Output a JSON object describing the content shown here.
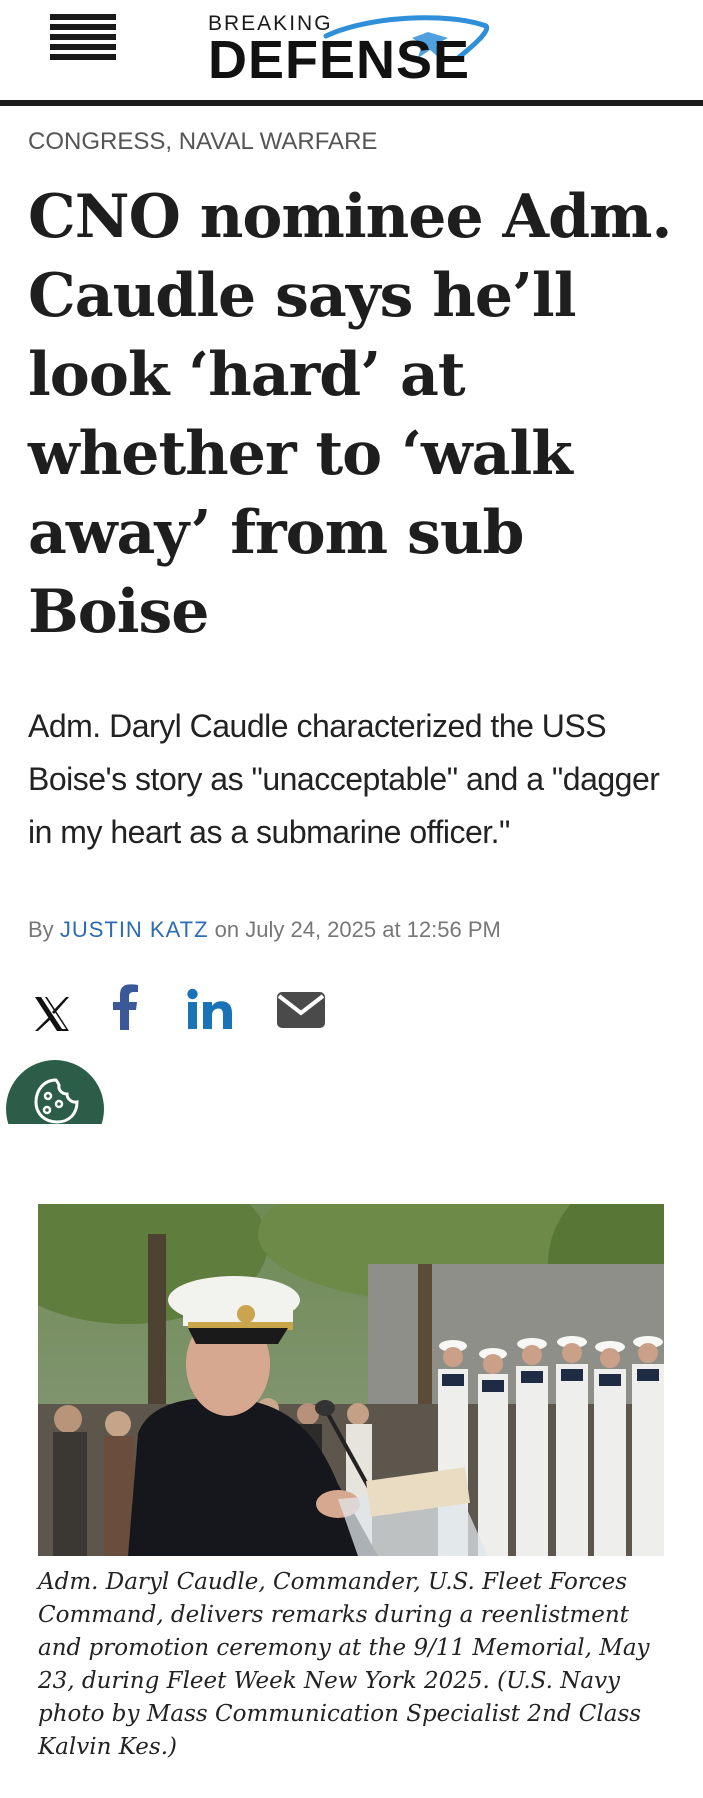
{
  "header": {
    "logo_top": "BREAKING",
    "logo_bottom": "DEFENSE",
    "menu_icon": "hamburger-menu-icon"
  },
  "article": {
    "categories": [
      "CONGRESS",
      "NAVAL WARFARE"
    ],
    "category_separator": ",",
    "headline": "CNO nominee Adm. Caudle says he’ll look ‘hard’ at whether to ‘walk away’ from sub Boise",
    "dek": "Adm. Daryl Caudle characterized the USS Boise's story as \"unacceptable\" and a \"dagger in my heart as a submarine officer.\"",
    "byline": {
      "prefix": "By",
      "author": "JUSTIN KATZ",
      "date_text": "on July 24, 2025 at 12:56 PM"
    },
    "share": [
      {
        "name": "x-icon",
        "label": "X"
      },
      {
        "name": "facebook-icon",
        "label": "f"
      },
      {
        "name": "linkedin-icon",
        "label": "in"
      },
      {
        "name": "email-icon",
        "label": "email"
      }
    ],
    "photo_caption": "Adm. Daryl Caudle, Commander, U.S. Fleet Forces Command, delivers remarks during a reenlistment and promotion ceremony at the 9/11 Memorial, May 23, during Fleet Week New York 2025. (U.S. Navy photo by Mass Communication Specialist 2nd Class Kalvin Kes.)"
  },
  "colors": {
    "author_link": "#2c6cb3",
    "facebook": "#3b5998",
    "linkedin": "#1a73b6",
    "cookie_bubble": "#2c5d48",
    "logo_swoosh": "#2f8fd8"
  }
}
